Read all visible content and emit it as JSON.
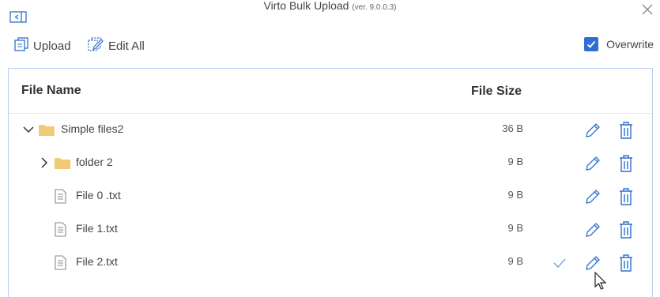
{
  "window": {
    "title": "Virto Bulk Upload",
    "version": "(ver. 9.0.0.3)"
  },
  "toolbar": {
    "upload_label": "Upload",
    "edit_all_label": "Edit All",
    "overwrite_label": "Overwrite",
    "overwrite_checked": true
  },
  "grid": {
    "columns": {
      "name": "File Name",
      "size": "File Size"
    },
    "rows": [
      {
        "name": "Simple files2",
        "size": "36 B",
        "type": "folder",
        "expanded": true,
        "level": 0
      },
      {
        "name": "folder 2",
        "size": "9 B",
        "type": "folder",
        "expanded": false,
        "level": 1
      },
      {
        "name": "File 0 .txt",
        "size": "9 B",
        "type": "file",
        "level": 1
      },
      {
        "name": "File 1.txt",
        "size": "9 B",
        "type": "file",
        "level": 1
      },
      {
        "name": "File 2.txt",
        "size": "9 B",
        "type": "file",
        "level": 1,
        "saved": true
      }
    ]
  },
  "colors": {
    "accent": "#2f6fd1",
    "folder": "#f2c975",
    "border": "#b7cfee"
  }
}
